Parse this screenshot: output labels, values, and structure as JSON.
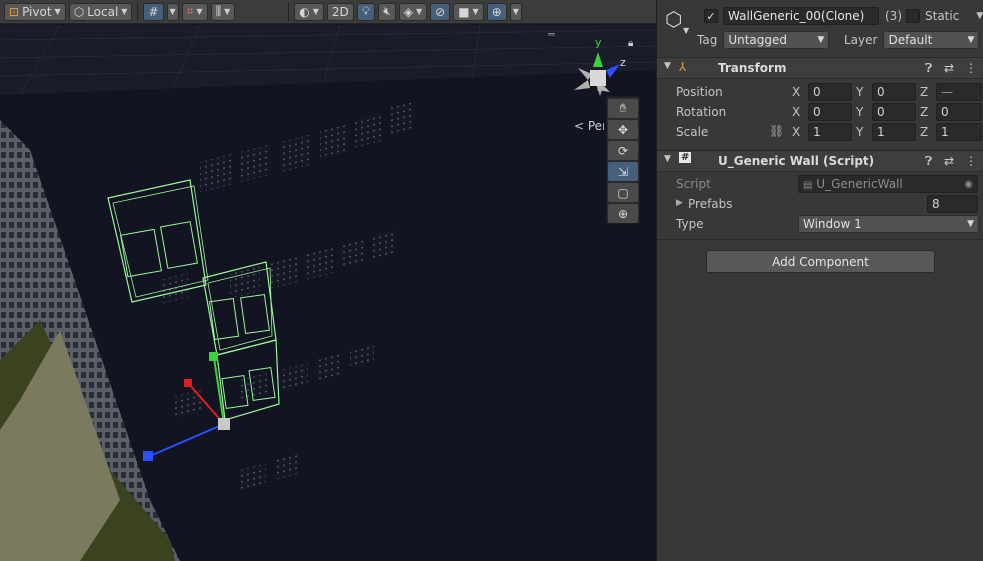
{
  "toolbar": {
    "pivot_label": "Pivot",
    "space_label": "Local",
    "mode_2d_label": "2D"
  },
  "scene": {
    "perspective_label": "Persp",
    "gizmo_axes": {
      "y": "y",
      "z": "z"
    }
  },
  "inspector": {
    "object_name": "WallGeneric_00(Clone)",
    "selection_count": "(3)",
    "static_label": "Static",
    "tag_label": "Tag",
    "tag_value": "Untagged",
    "layer_label": "Layer",
    "layer_value": "Default",
    "transform": {
      "title": "Transform",
      "position_label": "Position",
      "rotation_label": "Rotation",
      "scale_label": "Scale",
      "position": {
        "x": "0",
        "y": "0",
        "z": "—"
      },
      "rotation": {
        "x": "0",
        "y": "0",
        "z": "0"
      },
      "scale": {
        "x": "1",
        "y": "1",
        "z": "1"
      },
      "axis_labels": {
        "x": "X",
        "y": "Y",
        "z": "Z"
      }
    },
    "script_component": {
      "title": "U_Generic Wall (Script)",
      "script_label": "Script",
      "script_value": "U_GenericWall",
      "prefabs_label": "Prefabs",
      "prefabs_value": "8",
      "type_label": "Type",
      "type_value": "Window 1"
    },
    "add_component_label": "Add Component"
  },
  "colors": {
    "accent_active": "#46607c",
    "gizmo_x": "#e02020",
    "gizmo_y": "#3ad43a",
    "gizmo_z": "#2850ff",
    "selection_outline": "#9cf59c"
  }
}
